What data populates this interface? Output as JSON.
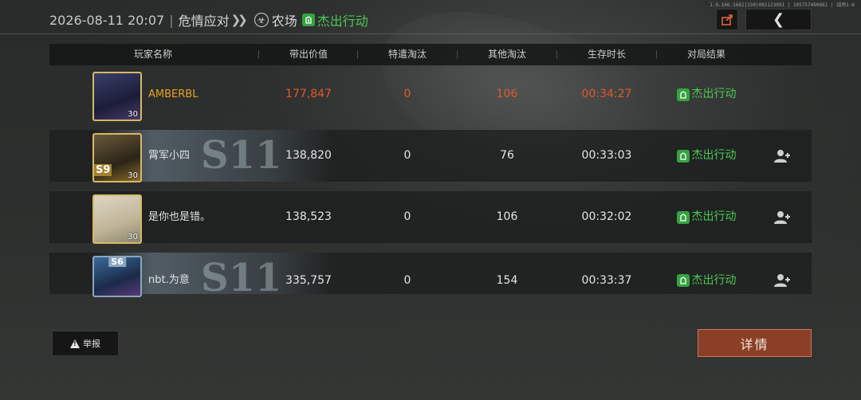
{
  "watermark": "1.0.166.1661|150|081123091 | 105757490861 | 战场1-6",
  "header": {
    "datetime": "2026-08-11 20:07",
    "separator": "|",
    "mode": "危情应对",
    "map": "农场",
    "result": "杰出行动"
  },
  "columns": {
    "player": "玩家名称",
    "value": "带出价值",
    "special_kills": "特遣淘汰",
    "other_kills": "其他淘汰",
    "survival": "生存时长",
    "outcome": "对局结果"
  },
  "rows": [
    {
      "level": "30",
      "name": "AMBERBL",
      "value": "177,847",
      "special": "0",
      "other": "106",
      "time": "00:34:27",
      "outcome": "杰出行动"
    },
    {
      "level": "30",
      "badge": "S9",
      "name": "霄军小四",
      "value": "138,820",
      "special": "0",
      "other": "76",
      "time": "00:33:03",
      "outcome": "杰出行动"
    },
    {
      "level": "30",
      "name": "是你也是错。",
      "value": "138,523",
      "special": "0",
      "other": "106",
      "time": "00:32:02",
      "outcome": "杰出行动"
    },
    {
      "topbadge": "S6",
      "name": "nbt.为意",
      "value": "335,757",
      "special": "0",
      "other": "154",
      "time": "00:33:37",
      "outcome": "杰出行动"
    }
  ],
  "season_mark": "S11",
  "buttons": {
    "report": "举报",
    "details": "详情"
  },
  "colors": {
    "accent_green": "#4cc855",
    "self_name": "#e8a21e",
    "self_stats": "#e05a2a",
    "details_bg": "#8a3f26",
    "avatar_border": "#d7b865"
  }
}
